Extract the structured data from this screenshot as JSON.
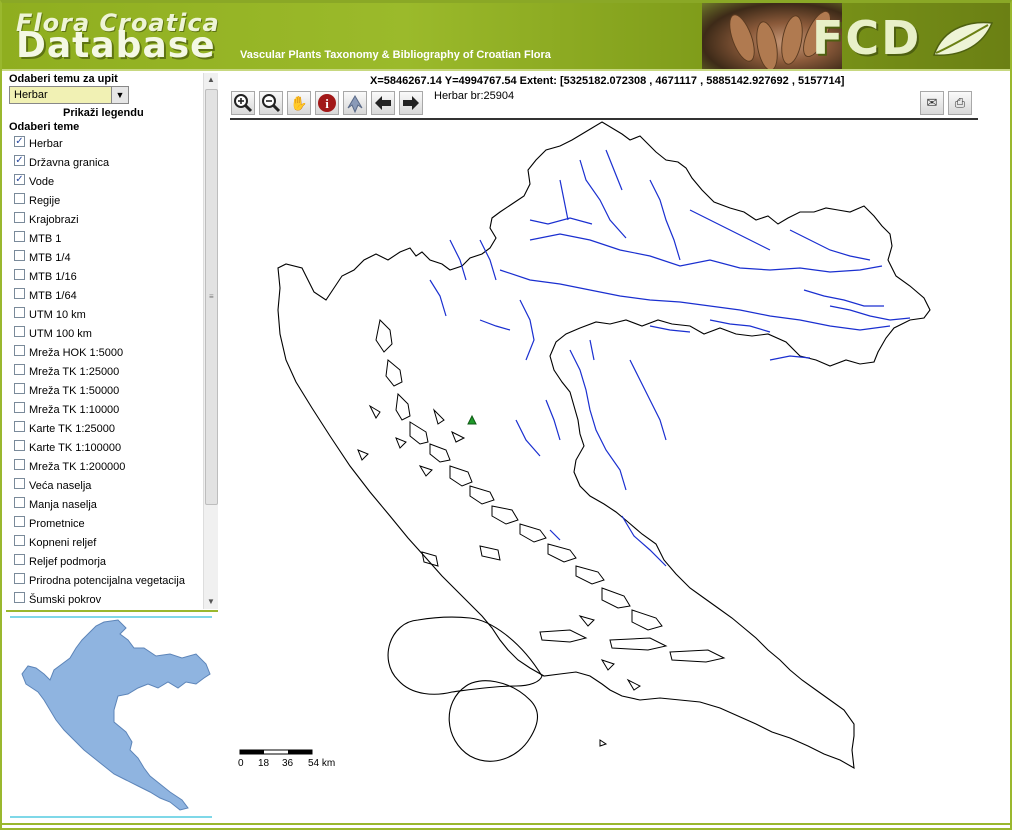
{
  "header": {
    "logo_line1": "Flora Croatica",
    "logo_line2": "Database",
    "subtitle": "Vascular Plants Taxonomy & Bibliography of Croatian Flora",
    "brand": "FCD"
  },
  "sidebar": {
    "theme_label": "Odaberi temu za upit",
    "theme_selected": "Herbar",
    "legend_link": "Prikaži legendu",
    "layers_label": "Odaberi teme",
    "layers": [
      {
        "label": "Herbar",
        "checked": true
      },
      {
        "label": "Državna granica",
        "checked": true
      },
      {
        "label": "Vode",
        "checked": true
      },
      {
        "label": "Regije",
        "checked": false
      },
      {
        "label": "Krajobrazi",
        "checked": false
      },
      {
        "label": "MTB 1",
        "checked": false
      },
      {
        "label": "MTB 1/4",
        "checked": false
      },
      {
        "label": "MTB 1/16",
        "checked": false
      },
      {
        "label": "MTB 1/64",
        "checked": false
      },
      {
        "label": "UTM 10 km",
        "checked": false
      },
      {
        "label": "UTM 100 km",
        "checked": false
      },
      {
        "label": "Mreža HOK 1:5000",
        "checked": false
      },
      {
        "label": "Mreža TK 1:25000",
        "checked": false
      },
      {
        "label": "Mreža TK 1:50000",
        "checked": false
      },
      {
        "label": "Mreža TK 1:10000",
        "checked": false
      },
      {
        "label": "Karte TK 1:25000",
        "checked": false
      },
      {
        "label": "Karte TK 1:100000",
        "checked": false
      },
      {
        "label": "Mreža TK 1:200000",
        "checked": false
      },
      {
        "label": "Veća naselja",
        "checked": false
      },
      {
        "label": "Manja naselja",
        "checked": false
      },
      {
        "label": "Prometnice",
        "checked": false
      },
      {
        "label": "Kopneni reljef",
        "checked": false
      },
      {
        "label": "Reljef podmorja",
        "checked": false
      },
      {
        "label": "Prirodna potencijalna vegetacija",
        "checked": false
      },
      {
        "label": "Šumski pokrov",
        "checked": false
      }
    ]
  },
  "map": {
    "coords": "X=5846267.14 Y=4994767.54 Extent: [5325182.072308 , 4671117 , 5885142.927692 , 5157714]",
    "info": "Herbar br:25904",
    "scale_labels": [
      "0",
      "18",
      "36",
      "54 km"
    ],
    "border_color": "#000000",
    "water_color": "#1a2fd0",
    "marker_color": "#1f9a2a",
    "overview_fill": "#8fb4e0"
  },
  "toolbar": {
    "tools": [
      "zoom-in-icon",
      "zoom-out-icon",
      "pan-hand-icon",
      "info-icon",
      "select-arrow-icon",
      "back-arrow-icon",
      "forward-arrow-icon"
    ],
    "right_tools": [
      "mail-icon",
      "print-icon"
    ]
  }
}
